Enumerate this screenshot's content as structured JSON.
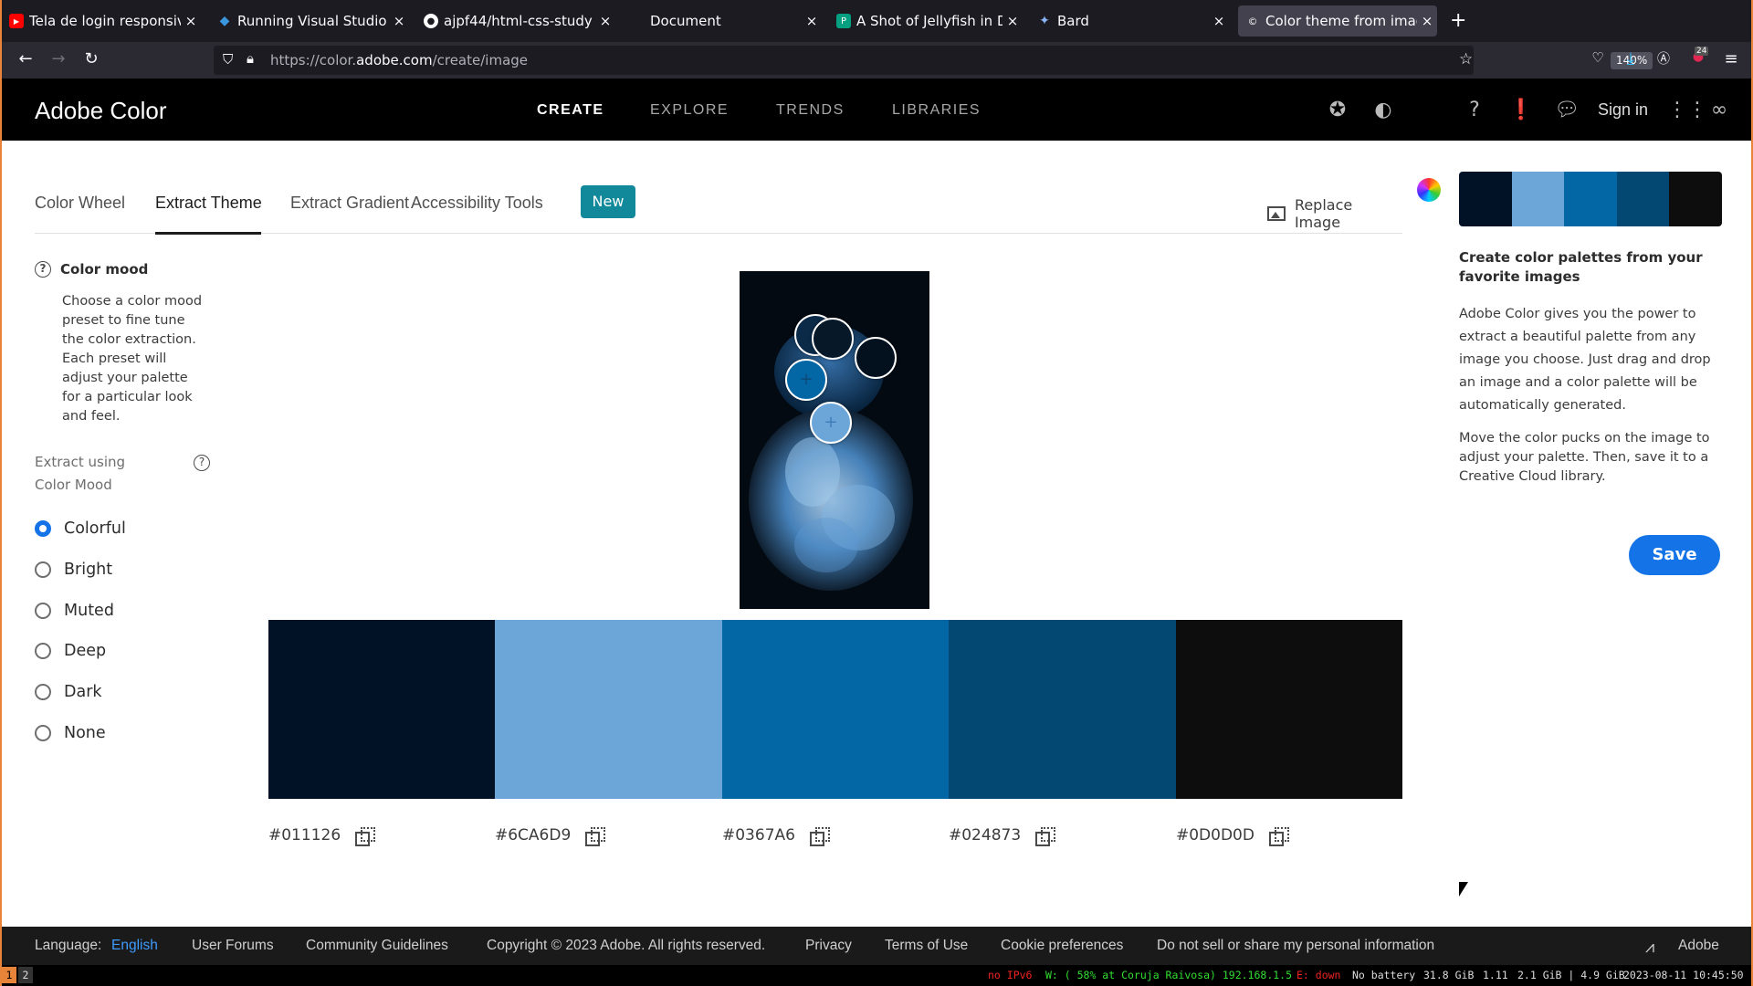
{
  "browser": {
    "tabs": [
      {
        "title": "Tela de login responsiva",
        "icon": "youtube-icon",
        "color": "#ff0000"
      },
      {
        "title": "Running Visual Studio Co",
        "icon": "vscode-icon",
        "color": "#3a96dd"
      },
      {
        "title": "ajpf44/html-css-study",
        "icon": "github-icon",
        "color": "#ffffff"
      },
      {
        "title": "Document",
        "icon": "",
        "color": ""
      },
      {
        "title": "A Shot of Jellyfish in Dark",
        "icon": "pexels-icon",
        "color": "#05a081"
      },
      {
        "title": "Bard",
        "icon": "bard-icon",
        "color": "#8ab4f8"
      },
      {
        "title": "Color theme from image",
        "icon": "adobe-color-icon",
        "color": "#ffffff"
      }
    ],
    "url_prefix": "https://color.",
    "url_domain": "adobe.com",
    "url_path": "/create/image",
    "zoom": "140%",
    "extension_badge": "24"
  },
  "header": {
    "logo": "Adobe Color",
    "nav": [
      "CREATE",
      "EXPLORE",
      "TRENDS",
      "LIBRARIES"
    ],
    "signin": "Sign in"
  },
  "tabs": {
    "items": [
      "Color Wheel",
      "Extract Theme",
      "Extract Gradient",
      "Accessibility Tools"
    ],
    "badge": "New",
    "replace_image": "Replace Image"
  },
  "left": {
    "mood_title": "Color mood",
    "mood_desc": "Choose a color mood preset to fine tune the color extraction. Each preset will adjust your palette for a particular look and feel.",
    "extract_label": "Extract using Color Mood",
    "options": [
      "Colorful",
      "Bright",
      "Muted",
      "Deep",
      "Dark",
      "None"
    ],
    "selected": "Colorful"
  },
  "palette": {
    "colors": [
      "#011126",
      "#6CA6D9",
      "#0367A6",
      "#024873",
      "#0D0D0D"
    ],
    "hex_labels": [
      "#011126",
      "#6CA6D9",
      "#0367A6",
      "#024873",
      "#0D0D0D"
    ]
  },
  "right": {
    "heading": "Create color palettes from your favorite images",
    "p1": "Adobe Color gives you the power to extract a beautiful palette from any image you choose. Just drag and drop an image and a color palette will be automatically generated.",
    "p2": "Move the color pucks on the image to adjust your palette. Then, save it to a Creative Cloud library.",
    "save": "Save"
  },
  "footer": {
    "language_label": "Language:",
    "language_value": "English",
    "links": [
      "User Forums",
      "Community Guidelines",
      "Copyright © 2023 Adobe. All rights reserved.",
      "Privacy",
      "Terms of Use",
      "Cookie preferences",
      "Do not sell or share my personal information"
    ],
    "brand": "Adobe"
  },
  "statusbar": {
    "workspaces": [
      "1",
      "2"
    ],
    "ipv6": "no IPv6",
    "wifi": "W: ( 58% at Coruja Raivosa) 192.168.1.5",
    "eth": "E: down",
    "battery": "No battery",
    "disk": "31.8 GiB",
    "load": "1.11",
    "mem": "2.1 GiB | 4.9 GiB",
    "datetime": "2023-08-11 10:45:50"
  }
}
